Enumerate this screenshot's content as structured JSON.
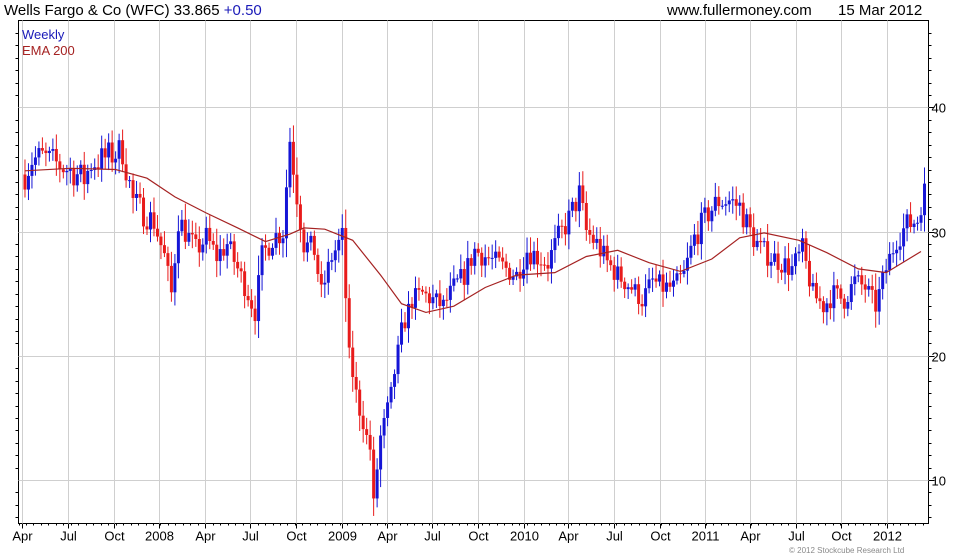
{
  "header": {
    "title": "Wells Fargo & Co (WFC) 33.865",
    "change": "+0.50",
    "site": "www.fullermoney.com",
    "date": "15 Mar 2012"
  },
  "legend": {
    "series1": "Weekly",
    "series2": "EMA 200"
  },
  "footer": {
    "copyright": "© 2012 Stockcube Research Ltd"
  },
  "colors": {
    "up": "#1515d6",
    "down": "#e81b1b",
    "ema": "#a52222",
    "title_change": "#1a1ab8",
    "legend1": "#1a1ab8",
    "legend2": "#a52222",
    "grid": "#cfcfcf"
  },
  "chart_data": {
    "type": "candlestick",
    "title": "Wells Fargo & Co (WFC) 33.865 +0.50",
    "ylim": [
      6.5,
      47
    ],
    "yticks": [
      10,
      20,
      30,
      40
    ],
    "xlim": [
      "2007-03-24",
      "2012-03-24"
    ],
    "xtick_labels": [
      "Apr",
      "Jul",
      "Oct",
      "2008",
      "Apr",
      "Jul",
      "Oct",
      "2009",
      "Apr",
      "Jul",
      "Oct",
      "2010",
      "Apr",
      "Jul",
      "Oct",
      "2011",
      "Apr",
      "Jul",
      "Oct",
      "2012"
    ],
    "xtick_dates": [
      "2007-04-01",
      "2007-07-01",
      "2007-10-01",
      "2008-01-01",
      "2008-04-01",
      "2008-07-01",
      "2008-10-01",
      "2009-01-01",
      "2009-04-01",
      "2009-07-01",
      "2009-10-01",
      "2010-01-01",
      "2010-04-01",
      "2010-07-01",
      "2010-10-01",
      "2011-01-01",
      "2011-04-01",
      "2011-07-01",
      "2011-10-01",
      "2012-01-01"
    ],
    "grid": true,
    "series": [
      {
        "name": "Weekly",
        "kind": "weekly_ohlc_bars",
        "start_date": "2007-04-06",
        "interval_days": 7,
        "close_path": [
          [
            "2007-04-06",
            34.6
          ],
          [
            "2007-04-20",
            35.8
          ],
          [
            "2007-05-11",
            36.0
          ],
          [
            "2007-06-01",
            35.6
          ],
          [
            "2007-06-22",
            35.2
          ],
          [
            "2007-07-13",
            34.8
          ],
          [
            "2007-08-03",
            34.2
          ],
          [
            "2007-08-17",
            35.5
          ],
          [
            "2007-09-07",
            35.8
          ],
          [
            "2007-09-28",
            36.2
          ],
          [
            "2007-10-19",
            36.5
          ],
          [
            "2007-11-09",
            32.5
          ],
          [
            "2007-11-30",
            31.5
          ],
          [
            "2007-12-21",
            30.8
          ],
          [
            "2008-01-11",
            28.0
          ],
          [
            "2008-01-25",
            25.0
          ],
          [
            "2008-02-08",
            31.0
          ],
          [
            "2008-02-22",
            30.0
          ],
          [
            "2008-03-14",
            28.5
          ],
          [
            "2008-04-04",
            29.5
          ],
          [
            "2008-04-25",
            28.0
          ],
          [
            "2008-05-16",
            29.0
          ],
          [
            "2008-06-06",
            27.0
          ],
          [
            "2008-06-27",
            25.0
          ],
          [
            "2008-07-11",
            23.5
          ],
          [
            "2008-07-25",
            28.0
          ],
          [
            "2008-08-15",
            29.5
          ],
          [
            "2008-09-05",
            30.0
          ],
          [
            "2008-09-19",
            37.5
          ],
          [
            "2008-10-03",
            33.0
          ],
          [
            "2008-10-17",
            29.0
          ],
          [
            "2008-11-07",
            28.5
          ],
          [
            "2008-11-21",
            25.0
          ],
          [
            "2008-12-12",
            28.0
          ],
          [
            "2009-01-02",
            29.5
          ],
          [
            "2009-01-16",
            20.0
          ],
          [
            "2009-02-06",
            15.5
          ],
          [
            "2009-02-27",
            12.5
          ],
          [
            "2009-03-06",
            8.3
          ],
          [
            "2009-03-20",
            13.5
          ],
          [
            "2009-04-10",
            17.0
          ],
          [
            "2009-05-01",
            22.0
          ],
          [
            "2009-05-22",
            24.5
          ],
          [
            "2009-06-12",
            25.0
          ],
          [
            "2009-07-03",
            24.5
          ],
          [
            "2009-07-24",
            24.0
          ],
          [
            "2009-08-14",
            25.5
          ],
          [
            "2009-09-04",
            26.5
          ],
          [
            "2009-09-25",
            28.5
          ],
          [
            "2009-10-16",
            28.0
          ],
          [
            "2009-11-06",
            27.5
          ],
          [
            "2009-11-27",
            27.0
          ],
          [
            "2009-12-18",
            26.5
          ],
          [
            "2010-01-08",
            28.5
          ],
          [
            "2010-01-29",
            28.0
          ],
          [
            "2010-02-19",
            27.5
          ],
          [
            "2010-03-12",
            29.5
          ],
          [
            "2010-04-02",
            31.0
          ],
          [
            "2010-04-23",
            33.0
          ],
          [
            "2010-05-07",
            30.0
          ],
          [
            "2010-05-28",
            29.0
          ],
          [
            "2010-06-18",
            27.5
          ],
          [
            "2010-07-09",
            26.5
          ],
          [
            "2010-08-06",
            25.5
          ],
          [
            "2010-08-27",
            24.5
          ],
          [
            "2010-09-17",
            26.0
          ],
          [
            "2010-10-08",
            25.5
          ],
          [
            "2010-10-29",
            25.5
          ],
          [
            "2010-11-19",
            26.5
          ],
          [
            "2010-12-10",
            29.5
          ],
          [
            "2011-01-07",
            31.5
          ],
          [
            "2011-01-28",
            32.5
          ],
          [
            "2011-02-18",
            32.5
          ],
          [
            "2011-03-11",
            32.0
          ],
          [
            "2011-04-01",
            30.0
          ],
          [
            "2011-04-22",
            28.5
          ],
          [
            "2011-05-13",
            28.0
          ],
          [
            "2011-06-03",
            27.5
          ],
          [
            "2011-06-24",
            27.0
          ],
          [
            "2011-07-15",
            28.5
          ],
          [
            "2011-08-05",
            25.0
          ],
          [
            "2011-08-26",
            24.0
          ],
          [
            "2011-09-16",
            25.0
          ],
          [
            "2011-10-07",
            24.5
          ],
          [
            "2011-10-28",
            26.0
          ],
          [
            "2011-11-18",
            25.5
          ],
          [
            "2011-12-09",
            24.0
          ],
          [
            "2011-12-30",
            27.0
          ],
          [
            "2012-01-20",
            29.5
          ],
          [
            "2012-02-10",
            30.5
          ],
          [
            "2012-03-02",
            31.0
          ],
          [
            "2012-03-16",
            33.865
          ]
        ]
      },
      {
        "name": "EMA 200",
        "kind": "line",
        "points": [
          [
            "2007-04-06",
            34.9
          ],
          [
            "2007-07-06",
            35.1
          ],
          [
            "2007-10-05",
            35.0
          ],
          [
            "2007-12-07",
            34.3
          ],
          [
            "2008-02-01",
            32.8
          ],
          [
            "2008-04-04",
            31.5
          ],
          [
            "2008-06-06",
            30.3
          ],
          [
            "2008-08-01",
            29.2
          ],
          [
            "2008-09-19",
            29.8
          ],
          [
            "2008-10-17",
            30.3
          ],
          [
            "2008-11-28",
            30.2
          ],
          [
            "2009-01-23",
            29.3
          ],
          [
            "2009-03-20",
            26.5
          ],
          [
            "2009-05-01",
            24.2
          ],
          [
            "2009-06-19",
            23.5
          ],
          [
            "2009-08-14",
            24.0
          ],
          [
            "2009-10-16",
            25.5
          ],
          [
            "2009-12-18",
            26.5
          ],
          [
            "2010-03-05",
            26.7
          ],
          [
            "2010-05-07",
            28.0
          ],
          [
            "2010-07-09",
            28.5
          ],
          [
            "2010-09-10",
            27.5
          ],
          [
            "2010-11-12",
            26.8
          ],
          [
            "2011-01-14",
            27.8
          ],
          [
            "2011-03-11",
            29.5
          ],
          [
            "2011-04-29",
            29.9
          ],
          [
            "2011-07-08",
            29.3
          ],
          [
            "2011-09-02",
            28.3
          ],
          [
            "2011-11-04",
            27.0
          ],
          [
            "2011-12-30",
            26.7
          ],
          [
            "2012-03-09",
            28.4
          ]
        ]
      }
    ]
  }
}
